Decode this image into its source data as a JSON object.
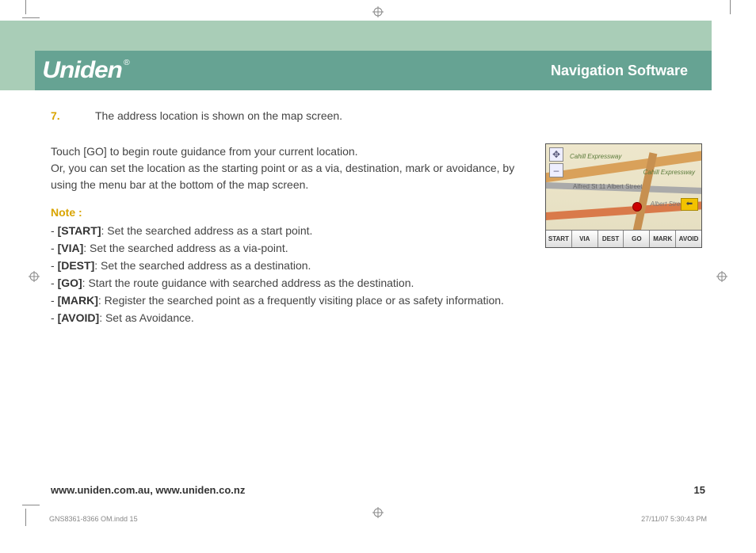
{
  "header": {
    "brand": "Uniden",
    "section_title": "Navigation Software"
  },
  "step": {
    "number": "7.",
    "text": "The address location is shown on the map screen."
  },
  "body": {
    "para1": "Touch [GO] to begin route guidance from your current location.",
    "para2": "Or, you can set the location as the starting point or as a via, destination, mark or avoidance, by using the menu bar at the bottom of the map screen."
  },
  "note": {
    "label": "Note :",
    "items": [
      {
        "key": "[START]",
        "desc": ": Set the searched address as a start point."
      },
      {
        "key": "[VIA]",
        "desc": ": Set the searched address as a via-point."
      },
      {
        "key": "[DEST]",
        "desc": ": Set the searched address as a destination."
      },
      {
        "key": "[GO]",
        "desc": ": Start the route guidance with searched address as the destination."
      },
      {
        "key": "[MARK]",
        "desc": ": Register the searched point as a frequently visiting place or as safety information."
      },
      {
        "key": "[AVOID]",
        "desc": ": Set as Avoidance."
      }
    ]
  },
  "map": {
    "labels": {
      "l1": "Cahill Expressway",
      "l2": "Cahill Expressway",
      "l3": "Albert Street",
      "l4": "Alfred St 11 Albert Street"
    },
    "toolbar": [
      "START",
      "VIA",
      "DEST",
      "GO",
      "MARK",
      "AVOID"
    ],
    "back_glyph": "⬅"
  },
  "footer": {
    "urls": "www.uniden.com.au, www.uniden.co.nz",
    "page_number": "15"
  },
  "print_meta": {
    "file": "GNS8361-8366 OM.indd   15",
    "timestamp": "27/11/07   5:30:43 PM"
  }
}
